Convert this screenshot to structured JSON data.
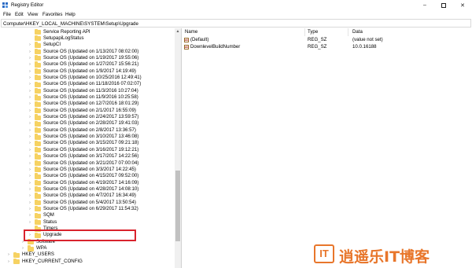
{
  "window": {
    "title": "Registry Editor"
  },
  "menu": [
    "File",
    "Edit",
    "View",
    "Favorites",
    "Help"
  ],
  "address": "Computer\\HKEY_LOCAL_MACHINE\\SYSTEM\\Setup\\Upgrade",
  "tree": [
    {
      "label": "Service Reporting API",
      "expand": ""
    },
    {
      "label": "SetupapiLogStatus",
      "expand": ""
    },
    {
      "label": "SetupCI",
      "expand": ">"
    },
    {
      "label": "Source OS (Updated on 1/13/2017 08:02:00)",
      "expand": ">"
    },
    {
      "label": "Source OS (Updated on 1/19/2017 19:55:06)",
      "expand": ">"
    },
    {
      "label": "Source OS (Updated on 1/27/2017 15:56:21)",
      "expand": ">"
    },
    {
      "label": "Source OS (Updated on 1/9/2017 14:19:49)",
      "expand": ">"
    },
    {
      "label": "Source OS (Updated on 10/25/2016 12:49:41)",
      "expand": ">"
    },
    {
      "label": "Source OS (Updated on 11/18/2016 07:02:07)",
      "expand": ">"
    },
    {
      "label": "Source OS (Updated on 11/3/2016 10:27:04)",
      "expand": ">"
    },
    {
      "label": "Source OS (Updated on 11/9/2016 10:25:58)",
      "expand": ">"
    },
    {
      "label": "Source OS (Updated on 12/7/2016 18:01:29)",
      "expand": ">"
    },
    {
      "label": "Source OS (Updated on 2/1/2017 16:55:09)",
      "expand": ">"
    },
    {
      "label": "Source OS (Updated on 2/24/2017 13:59:57)",
      "expand": ">"
    },
    {
      "label": "Source OS (Updated on 2/28/2017 19:41:03)",
      "expand": ">"
    },
    {
      "label": "Source OS (Updated on 2/8/2017 13:36:57)",
      "expand": ">"
    },
    {
      "label": "Source OS (Updated on 3/10/2017 13:46:08)",
      "expand": ">"
    },
    {
      "label": "Source OS (Updated on 3/15/2017 09:21:18)",
      "expand": ">"
    },
    {
      "label": "Source OS (Updated on 3/16/2017 19:12:21)",
      "expand": ">"
    },
    {
      "label": "Source OS (Updated on 3/17/2017 14:22:56)",
      "expand": ">"
    },
    {
      "label": "Source OS (Updated on 3/21/2017 07:00:04)",
      "expand": ">"
    },
    {
      "label": "Source OS (Updated on 3/3/2017 14:22:45)",
      "expand": ">"
    },
    {
      "label": "Source OS (Updated on 4/15/2017 09:52:00)",
      "expand": ">"
    },
    {
      "label": "Source OS (Updated on 4/19/2017 14:16:09)",
      "expand": ">"
    },
    {
      "label": "Source OS (Updated on 4/28/2017 14:08:10)",
      "expand": ">"
    },
    {
      "label": "Source OS (Updated on 4/7/2017 16:34:49)",
      "expand": ">"
    },
    {
      "label": "Source OS (Updated on 5/4/2017 13:50:54)",
      "expand": ">"
    },
    {
      "label": "Source OS (Updated on 6/29/2017 11:54:32)",
      "expand": ">"
    },
    {
      "label": "SQM",
      "expand": ">"
    },
    {
      "label": "Status",
      "expand": ">"
    },
    {
      "label": "Timers",
      "expand": ""
    },
    {
      "label": "Upgrade",
      "expand": ">"
    },
    {
      "label": "Software",
      "expand": ">"
    },
    {
      "label": "WPA",
      "expand": ">"
    }
  ],
  "tree_root": [
    {
      "label": "HKEY_USERS",
      "expand": ">"
    },
    {
      "label": "HKEY_CURRENT_CONFIG",
      "expand": ">"
    }
  ],
  "columns": {
    "name": "Name",
    "type": "Type",
    "data": "Data"
  },
  "values": [
    {
      "name": "(Default)",
      "type": "REG_SZ",
      "data": "(value not set)",
      "icon": "ab-string-icon"
    },
    {
      "name": "DownlevelBuildNumber",
      "type": "REG_SZ",
      "data": "10.0.16188",
      "icon": "ab-string-icon"
    }
  ],
  "watermark": {
    "text": "逍遥乐IT博客",
    "logo": "IT"
  },
  "colors": {
    "folder": "#f6d262",
    "highlight": "#d9232d",
    "watermark": "#e8762b"
  }
}
